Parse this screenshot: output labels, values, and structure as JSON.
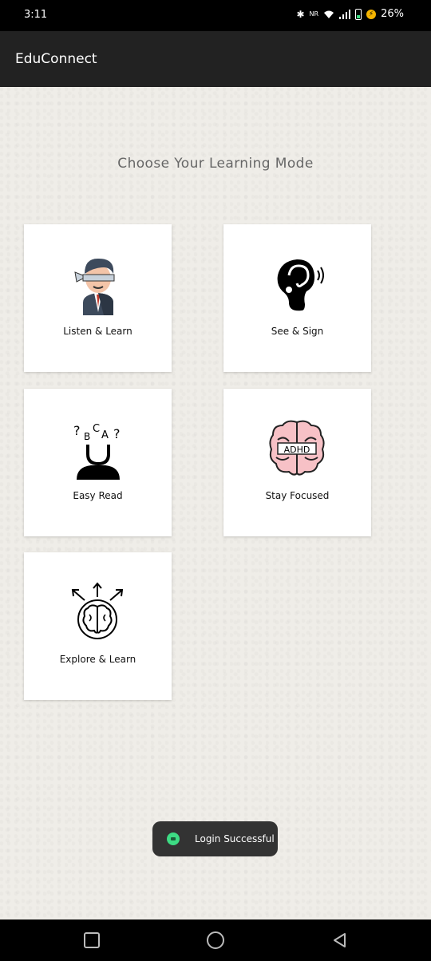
{
  "status_bar": {
    "time": "3:11",
    "battery": "26%",
    "icons": [
      "bluetooth-icon",
      "nr-icon",
      "wifi-icon",
      "signal-icon",
      "battery-icon",
      "charging-icon"
    ]
  },
  "app_bar": {
    "title": "EduConnect"
  },
  "main": {
    "heading": "Choose Your Learning Mode",
    "cards": [
      {
        "label": "Listen & Learn",
        "icon": "blindfolded-person-icon"
      },
      {
        "label": "See & Sign",
        "icon": "ear-sound-icon"
      },
      {
        "label": "Easy Read",
        "icon": "letters-head-icon"
      },
      {
        "label": "Stay Focused",
        "icon": "adhd-brain-icon"
      },
      {
        "label": "Explore & Learn",
        "icon": "brain-arrows-icon"
      }
    ],
    "adhd_text": "ADHD"
  },
  "toast": {
    "text": "Login Successful"
  },
  "nav_bar": {
    "buttons": [
      "recent-apps-icon",
      "home-icon",
      "back-icon"
    ]
  },
  "colors": {
    "app_bar": "#222222",
    "toast": "#333333",
    "accent": "#3ddc84"
  }
}
